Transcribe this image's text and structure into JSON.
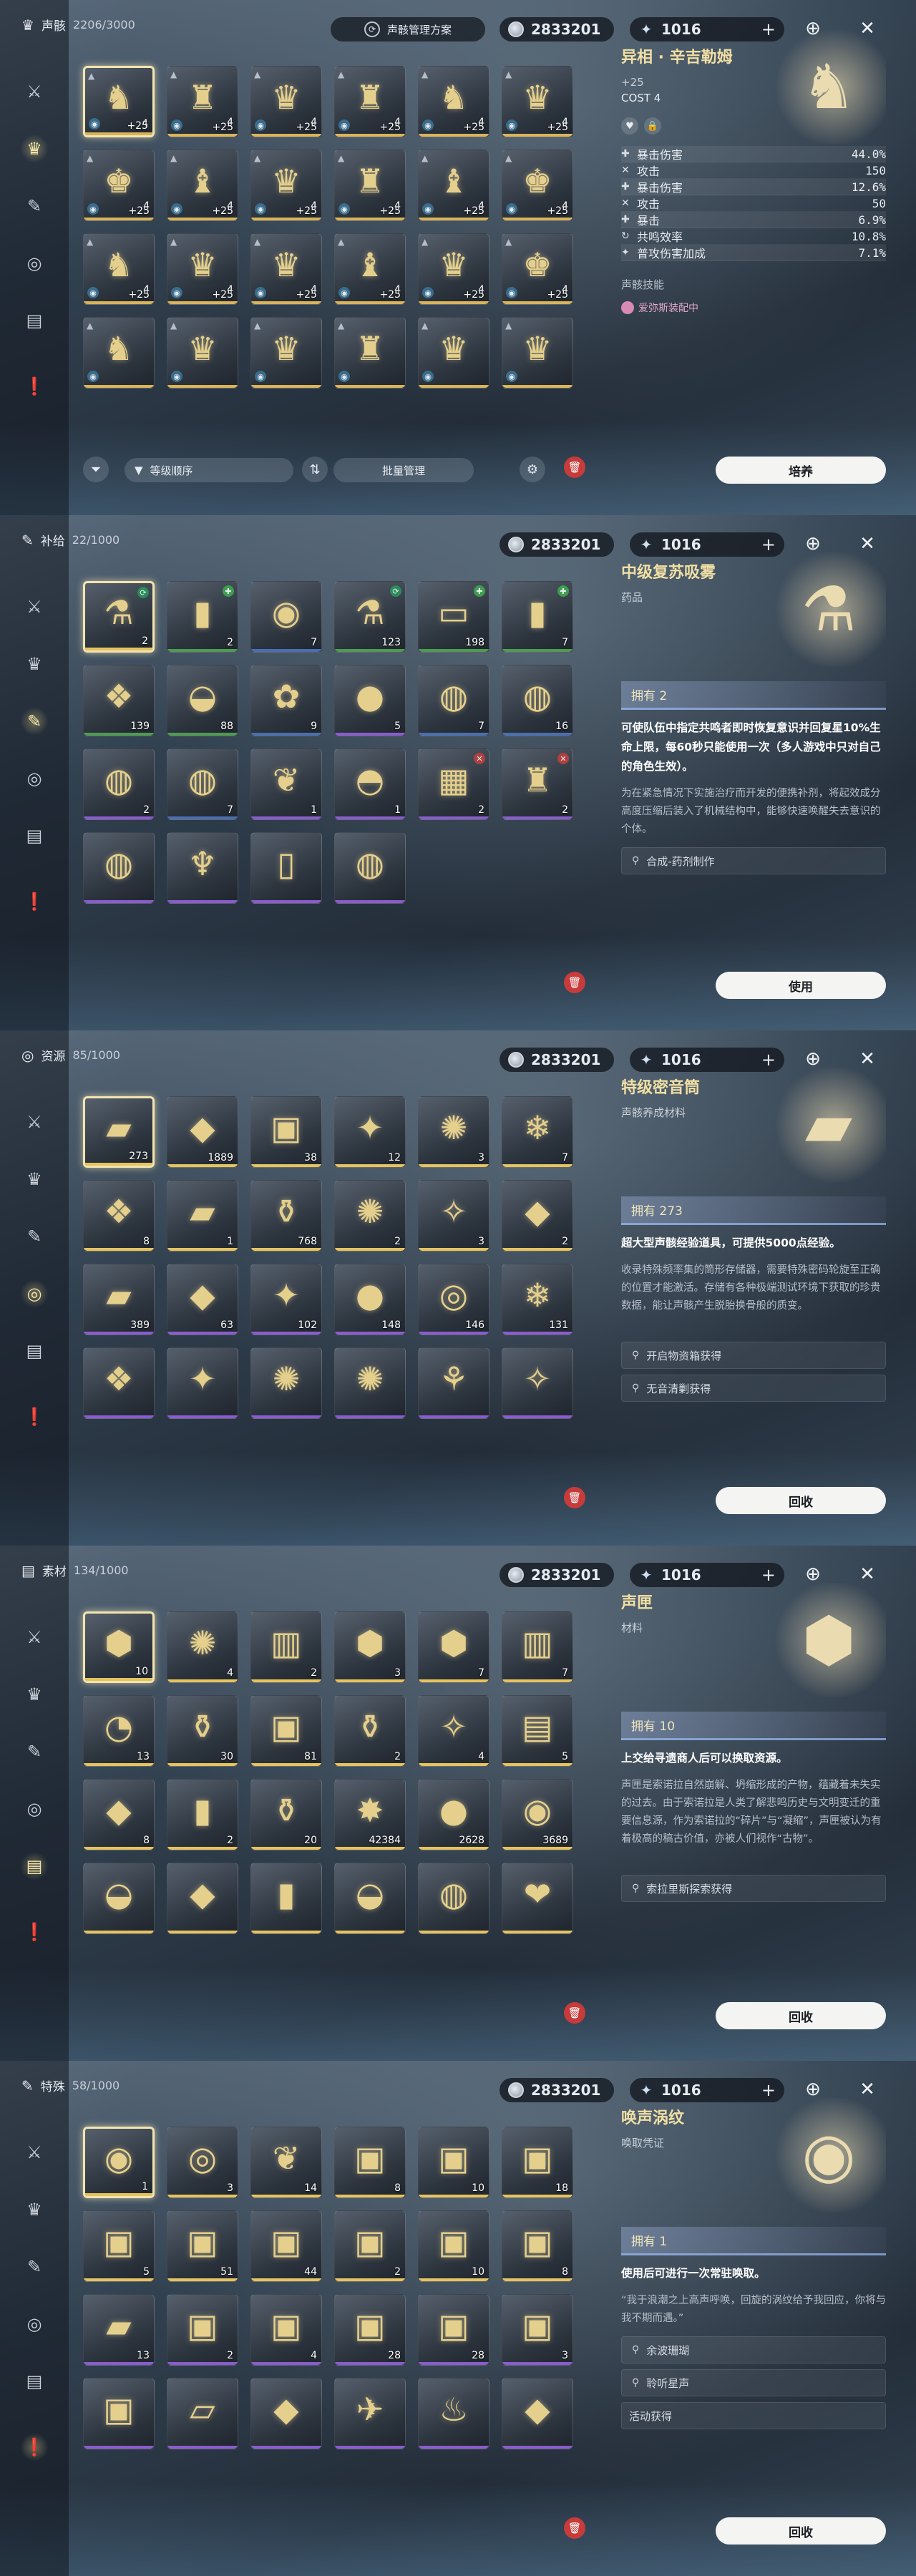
{
  "currency": {
    "credits": "2833201",
    "astrite": "1016",
    "plus": "+"
  },
  "sidebar_icons": [
    "crossed-swords-icon",
    "echo-mask-icon",
    "bandage-icon",
    "disc-icon",
    "chest-icon",
    "exclamation-icon"
  ],
  "panels": [
    {
      "kind": "echo",
      "category_label": "声骸",
      "count": "2206/3000",
      "active_side": 1,
      "plan_label": "声骸管理方案",
      "sort_label": "等级顺序",
      "batch_label": "批量管理",
      "cells": [
        {
          "icon": "♞",
          "num": "+25",
          "lvl": "4",
          "bar": "#d9b45a",
          "sel": true
        },
        {
          "icon": "♜",
          "num": "+25",
          "lvl": "4",
          "bar": "#d9b45a"
        },
        {
          "icon": "♛",
          "num": "+25",
          "lvl": "4",
          "bar": "#d9b45a"
        },
        {
          "icon": "♜",
          "num": "+25",
          "lvl": "4",
          "bar": "#d9b45a"
        },
        {
          "icon": "♞",
          "num": "+25",
          "lvl": "4",
          "bar": "#d9b45a"
        },
        {
          "icon": "♛",
          "num": "+25",
          "lvl": "4",
          "bar": "#d9b45a"
        },
        {
          "icon": "♚",
          "num": "+25",
          "lvl": "4",
          "bar": "#d9b45a"
        },
        {
          "icon": "♝",
          "num": "+25",
          "lvl": "4",
          "bar": "#d9b45a"
        },
        {
          "icon": "♛",
          "num": "+25",
          "lvl": "4",
          "bar": "#d9b45a"
        },
        {
          "icon": "♜",
          "num": "+25",
          "lvl": "4",
          "bar": "#d9b45a"
        },
        {
          "icon": "♝",
          "num": "+25",
          "lvl": "4",
          "bar": "#d9b45a"
        },
        {
          "icon": "♚",
          "num": "+25",
          "lvl": "4",
          "bar": "#d9b45a"
        },
        {
          "icon": "♞",
          "num": "+25",
          "lvl": "4",
          "bar": "#d9b45a"
        },
        {
          "icon": "♛",
          "num": "+25",
          "lvl": "4",
          "bar": "#d9b45a"
        },
        {
          "icon": "♛",
          "num": "+25",
          "lvl": "4",
          "bar": "#d9b45a"
        },
        {
          "icon": "♝",
          "num": "+25",
          "lvl": "4",
          "bar": "#d9b45a"
        },
        {
          "icon": "♛",
          "num": "+25",
          "lvl": "4",
          "bar": "#d9b45a"
        },
        {
          "icon": "♚",
          "num": "+25",
          "lvl": "4",
          "bar": "#d9b45a"
        },
        {
          "icon": "♞",
          "num": "",
          "lvl": "",
          "bar": "#d9b45a"
        },
        {
          "icon": "♛",
          "num": "",
          "lvl": "",
          "bar": "#d9b45a"
        },
        {
          "icon": "♛",
          "num": "",
          "lvl": "",
          "bar": "#d9b45a"
        },
        {
          "icon": "♜",
          "num": "",
          "lvl": "",
          "bar": "#d9b45a"
        },
        {
          "icon": "♛",
          "num": "",
          "lvl": "",
          "bar": "#d9b45a"
        },
        {
          "icon": "♛",
          "num": "",
          "lvl": "",
          "bar": "#d9b45a"
        }
      ],
      "detail": {
        "title": "异相 · 辛吉勒姆",
        "level": "+25",
        "cost": "COST  4",
        "stats": [
          {
            "icon": "✚",
            "name": "暴击伤害",
            "value": "44.0%"
          },
          {
            "icon": "✕",
            "name": "攻击",
            "value": "150"
          },
          {
            "icon": "✚",
            "name": "暴击伤害",
            "value": "12.6%"
          },
          {
            "icon": "✕",
            "name": "攻击",
            "value": "50"
          },
          {
            "icon": "✚",
            "name": "暴击",
            "value": "6.9%"
          },
          {
            "icon": "↻",
            "name": "共鸣效率",
            "value": "10.8%"
          },
          {
            "icon": "✦",
            "name": "普攻伤害加成",
            "value": "7.1%"
          }
        ],
        "skill_label": "声骸技能",
        "equipped_label": "爱弥斯装配中"
      },
      "button": "培养"
    },
    {
      "kind": "item",
      "category_label": "补给",
      "count": "22/1000",
      "active_side": 2,
      "cells": [
        {
          "icon": "⚗",
          "num": "2",
          "bar": "#e5c35f",
          "sel": true,
          "b": "⟳",
          "bc": "#2d8b5a"
        },
        {
          "icon": "▮",
          "num": "2",
          "bar": "#4f9b52",
          "b": "✚",
          "bc": "#3f9d4e"
        },
        {
          "icon": "◉",
          "num": "7",
          "bar": "#4a6fb0"
        },
        {
          "icon": "⚗",
          "num": "123",
          "bar": "#4f9b52",
          "b": "⟳",
          "bc": "#2d8b5a"
        },
        {
          "icon": "▭",
          "num": "198",
          "bar": "#4f9b52",
          "b": "✚",
          "bc": "#3f9d4e"
        },
        {
          "icon": "▮",
          "num": "7",
          "bar": "#4f9b52",
          "b": "✚",
          "bc": "#3f9d4e"
        },
        {
          "icon": "❖",
          "num": "139",
          "bar": "#4f9b52"
        },
        {
          "icon": "◒",
          "num": "88",
          "bar": "#4f9b52"
        },
        {
          "icon": "✿",
          "num": "9",
          "bar": "#4a6fb0"
        },
        {
          "icon": "●",
          "num": "5",
          "bar": "#8a5ccf"
        },
        {
          "icon": "◍",
          "num": "7",
          "bar": "#4a6fb0"
        },
        {
          "icon": "◍",
          "num": "16",
          "bar": "#4a6fb0"
        },
        {
          "icon": "◍",
          "num": "2",
          "bar": "#8a5ccf"
        },
        {
          "icon": "◍",
          "num": "7",
          "bar": "#4a6fb0"
        },
        {
          "icon": "❦",
          "num": "1",
          "bar": "#8a5ccf"
        },
        {
          "icon": "◓",
          "num": "1",
          "bar": "#8a5ccf"
        },
        {
          "icon": "▦",
          "num": "2",
          "bar": "#8a5ccf",
          "b": "✕",
          "bc": "#b04040"
        },
        {
          "icon": "♜",
          "num": "2",
          "bar": "#8a5ccf",
          "b": "✕",
          "bc": "#b04040"
        },
        {
          "icon": "◍",
          "num": "",
          "bar": "#8a5ccf"
        },
        {
          "icon": "♆",
          "num": "",
          "bar": "#8a5ccf"
        },
        {
          "icon": "▯",
          "num": "",
          "bar": "#8a5ccf"
        },
        {
          "icon": "◍",
          "num": "",
          "bar": "#8a5ccf"
        }
      ],
      "detail": {
        "title": "中级复苏吸雾",
        "sub": "药品",
        "owned": "拥有 2",
        "bold": "可使队伍中指定共鸣者即时恢复意识并回复星10%生命上限，每60秒只能使用一次（多人游戏中只对自己的角色生效）。",
        "desc": "为在紧急情况下实施治疗而开发的便携补剂，将起效成分高度压缩后装入了机械结构中，能够快速唤醒失去意识的个体。",
        "sources": [
          "合成-药剂制作"
        ]
      },
      "button": "使用"
    },
    {
      "kind": "item",
      "category_label": "资源",
      "count": "85/1000",
      "active_side": 3,
      "cells": [
        {
          "icon": "▰",
          "num": "273",
          "bar": "#e5c35f",
          "sel": true
        },
        {
          "icon": "◆",
          "num": "1889",
          "bar": "#e5c35f"
        },
        {
          "icon": "▣",
          "num": "38",
          "bar": "#e5c35f"
        },
        {
          "icon": "✦",
          "num": "12",
          "bar": "#e5c35f"
        },
        {
          "icon": "✺",
          "num": "3",
          "bar": "#e5c35f"
        },
        {
          "icon": "❄",
          "num": "7",
          "bar": "#e5c35f"
        },
        {
          "icon": "❖",
          "num": "8",
          "bar": "#e5c35f"
        },
        {
          "icon": "▰",
          "num": "1",
          "bar": "#e5c35f"
        },
        {
          "icon": "⚱",
          "num": "768",
          "bar": "#e5c35f"
        },
        {
          "icon": "✺",
          "num": "2",
          "bar": "#e5c35f"
        },
        {
          "icon": "✧",
          "num": "3",
          "bar": "#e5c35f"
        },
        {
          "icon": "◆",
          "num": "2",
          "bar": "#e5c35f"
        },
        {
          "icon": "▰",
          "num": "389",
          "bar": "#8a5ccf"
        },
        {
          "icon": "◆",
          "num": "63",
          "bar": "#8a5ccf"
        },
        {
          "icon": "✦",
          "num": "102",
          "bar": "#8a5ccf"
        },
        {
          "icon": "●",
          "num": "148",
          "bar": "#8a5ccf"
        },
        {
          "icon": "◎",
          "num": "146",
          "bar": "#8a5ccf"
        },
        {
          "icon": "❄",
          "num": "131",
          "bar": "#8a5ccf"
        },
        {
          "icon": "❖",
          "num": "",
          "bar": "#8a5ccf"
        },
        {
          "icon": "✦",
          "num": "",
          "bar": "#8a5ccf"
        },
        {
          "icon": "✺",
          "num": "",
          "bar": "#8a5ccf"
        },
        {
          "icon": "✺",
          "num": "",
          "bar": "#8a5ccf"
        },
        {
          "icon": "⚘",
          "num": "",
          "bar": "#8a5ccf"
        },
        {
          "icon": "✧",
          "num": "",
          "bar": "#8a5ccf"
        }
      ],
      "detail": {
        "title": "特级密音筒",
        "sub": "声骸养成材料",
        "owned": "拥有 273",
        "bold": "超大型声骸经验道具，可提供5000点经验。",
        "desc": "收录特殊频率集的筒形存储器，需要特殊密码轮旋至正确的位置才能激活。存储有各种极端测试环境下获取的珍贵数据，能让声骸产生脱胎换骨般的质变。",
        "sources": [
          "开启物资箱获得",
          "无音清剿获得"
        ]
      },
      "button": "回收"
    },
    {
      "kind": "item",
      "category_label": "素材",
      "count": "134/1000",
      "active_side": 4,
      "cells": [
        {
          "icon": "⬢",
          "num": "10",
          "bar": "#e5c35f",
          "sel": true
        },
        {
          "icon": "✺",
          "num": "4",
          "bar": "#e5c35f"
        },
        {
          "icon": "▥",
          "num": "2",
          "bar": "#e5c35f"
        },
        {
          "icon": "⬢",
          "num": "3",
          "bar": "#e5c35f"
        },
        {
          "icon": "⬢",
          "num": "7",
          "bar": "#e5c35f"
        },
        {
          "icon": "▥",
          "num": "7",
          "bar": "#e5c35f"
        },
        {
          "icon": "◔",
          "num": "13",
          "bar": "#e5c35f"
        },
        {
          "icon": "⚱",
          "num": "30",
          "bar": "#e5c35f"
        },
        {
          "icon": "▣",
          "num": "81",
          "bar": "#e5c35f"
        },
        {
          "icon": "⚱",
          "num": "2",
          "bar": "#e5c35f"
        },
        {
          "icon": "✧",
          "num": "4",
          "bar": "#e5c35f"
        },
        {
          "icon": "▤",
          "num": "5",
          "bar": "#e5c35f"
        },
        {
          "icon": "◆",
          "num": "8",
          "bar": "#e5c35f"
        },
        {
          "icon": "▮",
          "num": "2",
          "bar": "#e5c35f"
        },
        {
          "icon": "⚱",
          "num": "20",
          "bar": "#e5c35f"
        },
        {
          "icon": "✸",
          "num": "42384",
          "bar": "#e5c35f"
        },
        {
          "icon": "●",
          "num": "2628",
          "bar": "#e5c35f"
        },
        {
          "icon": "◉",
          "num": "3689",
          "bar": "#e5c35f"
        },
        {
          "icon": "◒",
          "num": "",
          "bar": "#e5c35f"
        },
        {
          "icon": "◆",
          "num": "",
          "bar": "#e5c35f"
        },
        {
          "icon": "▮",
          "num": "",
          "bar": "#e5c35f"
        },
        {
          "icon": "◒",
          "num": "",
          "bar": "#e5c35f"
        },
        {
          "icon": "◍",
          "num": "",
          "bar": "#e5c35f"
        },
        {
          "icon": "❤",
          "num": "",
          "bar": "#e5c35f"
        }
      ],
      "detail": {
        "title": "声匣",
        "sub": "材料",
        "owned": "拥有 10",
        "bold": "上交给寻遗商人后可以换取资源。",
        "desc": "声匣是索诺拉自然崩解、坍缩形成的产物，蕴藏着未失实的过去。由于索诺拉是人类了解悲鸣历史与文明变迁的重要信息源，作为索诺拉的“碎片”与“凝缩”，声匣被认为有着极高的稿古价值，亦被人们视作“古物”。",
        "sources": [
          "索拉里斯探索获得"
        ]
      },
      "button": "回收"
    },
    {
      "kind": "item",
      "category_label": "特殊",
      "count": "58/1000",
      "active_side": 5,
      "cells": [
        {
          "icon": "◉",
          "num": "1",
          "bar": "#e5c35f",
          "sel": true
        },
        {
          "icon": "◎",
          "num": "3",
          "bar": "#e5c35f"
        },
        {
          "icon": "❦",
          "num": "14",
          "bar": "#e5c35f"
        },
        {
          "icon": "▣",
          "num": "8",
          "bar": "#e5c35f"
        },
        {
          "icon": "▣",
          "num": "10",
          "bar": "#e5c35f"
        },
        {
          "icon": "▣",
          "num": "18",
          "bar": "#e5c35f"
        },
        {
          "icon": "▣",
          "num": "5",
          "bar": "#e5c35f"
        },
        {
          "icon": "▣",
          "num": "51",
          "bar": "#e5c35f"
        },
        {
          "icon": "▣",
          "num": "44",
          "bar": "#e5c35f"
        },
        {
          "icon": "▣",
          "num": "2",
          "bar": "#e5c35f"
        },
        {
          "icon": "▣",
          "num": "10",
          "bar": "#e5c35f"
        },
        {
          "icon": "▣",
          "num": "8",
          "bar": "#e5c35f"
        },
        {
          "icon": "▰",
          "num": "13",
          "bar": "#8a5ccf"
        },
        {
          "icon": "▣",
          "num": "2",
          "bar": "#8a5ccf"
        },
        {
          "icon": "▣",
          "num": "4",
          "bar": "#8a5ccf"
        },
        {
          "icon": "▣",
          "num": "28",
          "bar": "#8a5ccf"
        },
        {
          "icon": "▣",
          "num": "28",
          "bar": "#8a5ccf"
        },
        {
          "icon": "▣",
          "num": "3",
          "bar": "#8a5ccf"
        },
        {
          "icon": "▣",
          "num": "",
          "bar": "#8a5ccf"
        },
        {
          "icon": "▱",
          "num": "",
          "bar": "#8a5ccf"
        },
        {
          "icon": "◆",
          "num": "",
          "bar": "#8a5ccf"
        },
        {
          "icon": "✈",
          "num": "",
          "bar": "#8a5ccf"
        },
        {
          "icon": "♨",
          "num": "",
          "bar": "#8a5ccf"
        },
        {
          "icon": "◆",
          "num": "",
          "bar": "#8a5ccf"
        }
      ],
      "detail": {
        "title": "唤声涡纹",
        "sub": "唤取凭证",
        "owned": "拥有 1",
        "bold": "使用后可进行一次常驻唤取。",
        "desc": "“我于浪潮之上高声呼唤，回旋的涡纹给予我回应，你将与我不期而遇。”",
        "sources": [
          "余波珊瑚",
          "聆听星声"
        ],
        "plain": "活动获得"
      },
      "button": "回收"
    }
  ]
}
